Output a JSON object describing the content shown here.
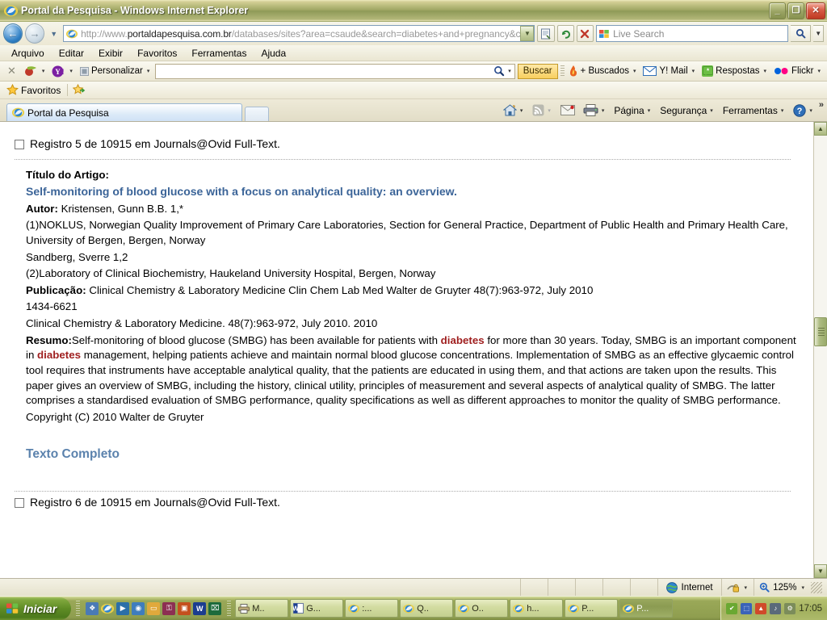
{
  "window": {
    "title": "Portal da Pesquisa - Windows Internet Explorer",
    "minimize_label": "_",
    "restore_label": "❐",
    "close_label": "✕"
  },
  "nav": {
    "back_glyph": "←",
    "forward_glyph": "→",
    "history_glyph": "▼",
    "address_prefix": "http://www.",
    "address_domain": "portaldapesquisa.com.br",
    "address_suffix": "/databases/sites?area=csaude&search=diabetes+and+pregnancy&c",
    "address_full": "http://www.portaldapesquisa.com.br/databases/sites?area=csaude&search=diabetes+and+pregnancy&c",
    "dropdown_glyph": "▼",
    "compat_label": "",
    "refresh_glyph": "↻",
    "stop_glyph": "✕",
    "search_placeholder": "Live Search",
    "search_value": "",
    "search_go_glyph": "⚲",
    "search_drop_glyph": "▼"
  },
  "menu": {
    "items": [
      "Arquivo",
      "Editar",
      "Exibir",
      "Favoritos",
      "Ferramentas",
      "Ajuda"
    ]
  },
  "yahoo_toolbar": {
    "close_glyph": "✕",
    "customize_label": "Personalizar",
    "search_value": "",
    "search_button_label": "Buscar",
    "items": [
      {
        "label": "+ Buscados",
        "icon": "flame-icon"
      },
      {
        "label": "Y! Mail",
        "icon": "mail-icon"
      },
      {
        "label": "Respostas",
        "icon": "answers-icon"
      },
      {
        "label": "Flickr",
        "icon": "flickr-icon"
      }
    ],
    "caret": "▾"
  },
  "favbar": {
    "label": "Favoritos",
    "star_glyph": "★"
  },
  "tabs": {
    "active_tab_label": "Portal da Pesquisa",
    "new_tab_tooltip": ""
  },
  "commandbar": {
    "items": [
      {
        "label": "",
        "icon": "home-icon",
        "caret": "▾"
      },
      {
        "label": "",
        "icon": "rss-icon",
        "caret": "▾"
      },
      {
        "label": "",
        "icon": "mail-icon",
        "caret": ""
      },
      {
        "label": "",
        "icon": "print-icon",
        "caret": "▾"
      },
      {
        "label": "Página",
        "icon": "",
        "caret": "▾"
      },
      {
        "label": "Segurança",
        "icon": "",
        "caret": "▾"
      },
      {
        "label": "Ferramentas",
        "icon": "",
        "caret": "▾"
      },
      {
        "label": "",
        "icon": "help-icon",
        "caret": "▾"
      }
    ],
    "overflow_glyph": "»"
  },
  "page": {
    "record_5": {
      "header": "Registro 5 de 10915 em Journals@Ovid Full-Text.",
      "title_label": "Título do Artigo:",
      "article_title": "Self-monitoring of blood glucose with a focus on analytical quality: an overview.",
      "author_label": "Autor:",
      "author_value": "Kristensen, Gunn B.B. 1,*",
      "affiliation_1": "(1)NOKLUS, Norwegian Quality Improvement of Primary Care Laboratories, Section for General Practice, Department of Public Health and Primary Health Care, University of Bergen, Bergen, Norway",
      "author_2": "Sandberg, Sverre 1,2",
      "affiliation_2": "(2)Laboratory of Clinical Biochemistry, Haukeland University Hospital, Bergen, Norway",
      "publication_label": "Publicação:",
      "publication_value": "Clinical Chemistry & Laboratory Medicine Clin Chem Lab Med Walter de Gruyter 48(7):963-972, July 2010",
      "issn": "1434-6621",
      "publication_citation": "Clinical Chemistry & Laboratory Medicine. 48(7):963-972, July 2010. 2010",
      "abstract_label": "Resumo:",
      "abstract_part_1": "Self-monitoring of blood glucose (SMBG) has been available for patients with ",
      "highlight_1": "diabetes",
      "abstract_part_2": " for more than 30 years. Today, SMBG is an important component in ",
      "highlight_2": "diabetes",
      "abstract_part_3": " management, helping patients achieve and maintain normal blood glucose concentrations. Implementation of SMBG as an effective glycaemic control tool requires that instruments have acceptable analytical quality, that the patients are educated in using them, and that actions are taken upon the results. This paper gives an overview of SMBG, including the history, clinical utility, principles of measurement and several aspects of analytical quality of SMBG. The latter comprises a standardised evaluation of SMBG performance, quality specifications as well as different approaches to monitor the quality of SMBG performance.",
      "copyright": "Copyright (C) 2010 Walter de Gruyter",
      "fulltext_link": "Texto Completo"
    },
    "record_6": {
      "header": "Registro 6 de 10915 em Journals@Ovid Full-Text."
    }
  },
  "scrollbar": {
    "up_glyph": "▲",
    "down_glyph": "▼"
  },
  "statusbar": {
    "zone_label": "Internet",
    "protected_caret": "▾",
    "zoom_label": "125%",
    "zoom_caret": "▾"
  },
  "taskbar": {
    "start_label": "Iniciar",
    "quick_launch": [
      {
        "name": "show-desktop-icon",
        "color": "#4a7ab5",
        "glyph": "❖"
      },
      {
        "name": "internet-explorer-icon",
        "color": "#2f7fc4",
        "glyph": "e"
      },
      {
        "name": "media-player-icon",
        "color": "#2b6fa8",
        "glyph": "▶"
      },
      {
        "name": "explorer-icon",
        "color": "#3f7dbd",
        "glyph": "◉"
      },
      {
        "name": "folder-icon",
        "color": "#e0a93c",
        "glyph": "▭"
      },
      {
        "name": "access-icon",
        "color": "#8c2f52",
        "glyph": "⚿"
      },
      {
        "name": "powerpoint-icon",
        "color": "#c4501e",
        "glyph": "▣"
      },
      {
        "name": "word-icon",
        "color": "#1b3d8f",
        "glyph": "W"
      },
      {
        "name": "excel-icon",
        "color": "#1d6b3c",
        "glyph": "⌧"
      }
    ],
    "buttons": [
      {
        "label": "M..",
        "icon": "printer-icon",
        "active": false
      },
      {
        "label": "G...",
        "icon": "word-icon",
        "active": false
      },
      {
        "label": ":...",
        "icon": "ie-icon",
        "active": false
      },
      {
        "label": "Q..",
        "icon": "ie-icon",
        "active": false
      },
      {
        "label": "O..",
        "icon": "ie-icon",
        "active": false
      },
      {
        "label": "h...",
        "icon": "ie-icon",
        "active": false
      },
      {
        "label": "P...",
        "icon": "ie-icon",
        "active": false
      },
      {
        "label": "P...",
        "icon": "ie-icon",
        "active": true
      }
    ],
    "tray_icons": [
      {
        "name": "shield-icon",
        "color": "#6aa832",
        "glyph": "✔"
      },
      {
        "name": "network-icon",
        "color": "#3a63b8",
        "glyph": "⬚"
      },
      {
        "name": "antivirus-icon",
        "color": "#d04a2a",
        "glyph": "▲"
      },
      {
        "name": "volume-icon",
        "color": "#5a6a7a",
        "glyph": "♪"
      },
      {
        "name": "update-icon",
        "color": "#7b8c5a",
        "glyph": "⚙"
      }
    ],
    "clock": "17:05"
  },
  "colors": {
    "accent_blue": "#3b6498",
    "link_blue": "#5b82ad",
    "highlight_red": "#a02020",
    "xp_olive": "#8e9a57"
  }
}
